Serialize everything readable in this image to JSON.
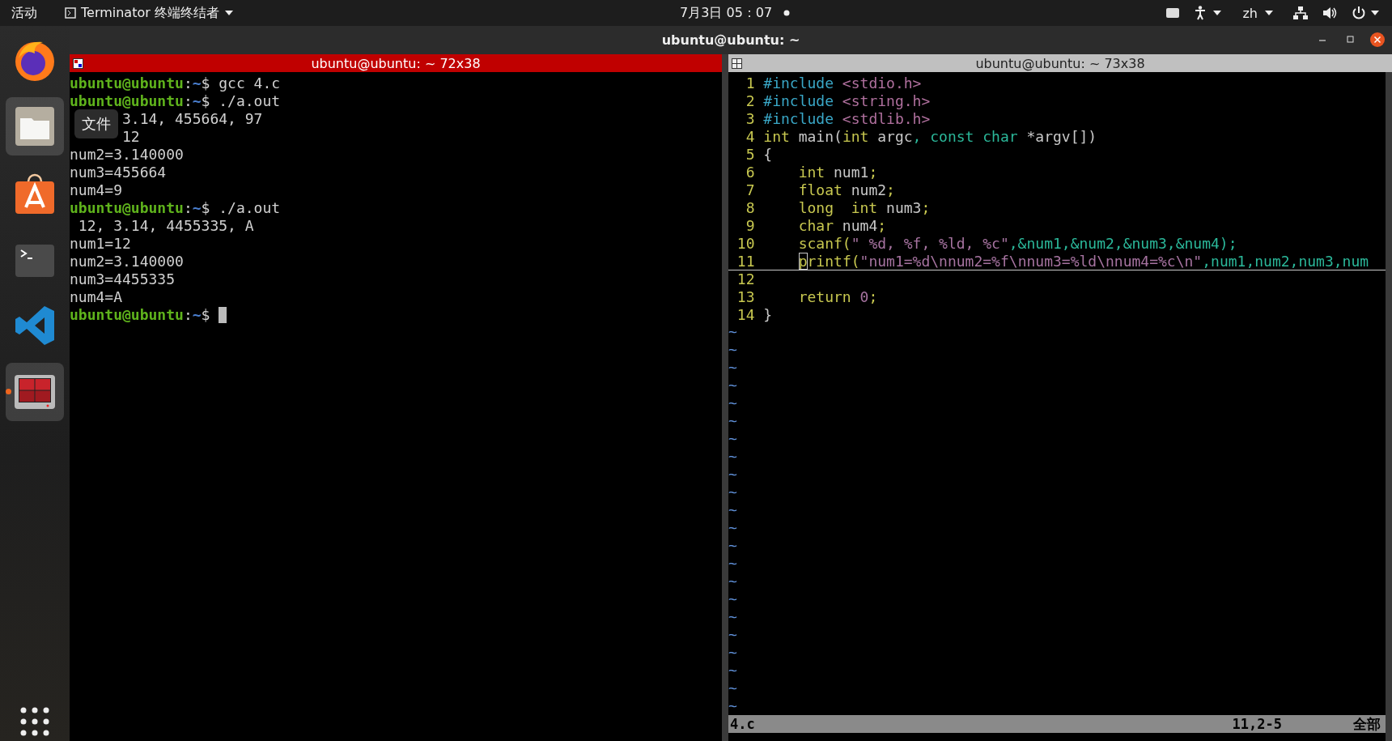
{
  "top_bar": {
    "activities": "活动",
    "app_menu": "Terminator 终端终结者",
    "clock": "7月3日 05：07",
    "notification_dot": true,
    "language": "zh"
  },
  "dock": {
    "items": [
      {
        "kind": "browser",
        "selected": false,
        "running": false
      },
      {
        "kind": "folder",
        "selected": true,
        "running": false
      },
      {
        "kind": "store",
        "selected": false,
        "running": false
      },
      {
        "kind": "console",
        "selected": false,
        "running": false
      },
      {
        "kind": "editor",
        "selected": false,
        "running": false
      },
      {
        "kind": "split",
        "selected": true,
        "running": true
      }
    ],
    "tooltip": "文件"
  },
  "window": {
    "title": "ubuntu@ubuntu: ~"
  },
  "panes": [
    {
      "title": "ubuntu@ubuntu: ~ 72x38",
      "active": true,
      "lines": [
        {
          "kind": "full",
          "segments": [
            {
              "text": "ubuntu@ubuntu",
              "kind": "user"
            },
            {
              "text": ":",
              "kind": "plain"
            },
            {
              "text": "~",
              "kind": "path"
            },
            {
              "text": "$ gcc 4.c",
              "kind": "plain"
            }
          ]
        },
        {
          "kind": "full",
          "segments": [
            {
              "text": "ubuntu@ubuntu",
              "kind": "user"
            },
            {
              "text": ":",
              "kind": "plain"
            },
            {
              "text": "~",
              "kind": "path"
            },
            {
              "text": "$ ./a.out",
              "kind": "plain"
            }
          ]
        },
        {
          "kind": "partial",
          "segments": [
            {
              "text": "3.14, 455664, 97",
              "kind": "plain"
            }
          ]
        },
        {
          "kind": "partial",
          "segments": [
            {
              "text": "12",
              "kind": "plain"
            }
          ]
        },
        {
          "kind": "full",
          "segments": [
            {
              "text": "num2=3.140000",
              "kind": "plain"
            }
          ]
        },
        {
          "kind": "full",
          "segments": [
            {
              "text": "num3=455664",
              "kind": "plain"
            }
          ]
        },
        {
          "kind": "full",
          "segments": [
            {
              "text": "num4=9",
              "kind": "plain"
            }
          ]
        },
        {
          "kind": "full",
          "segments": [
            {
              "text": "ubuntu@ubuntu",
              "kind": "user"
            },
            {
              "text": ":",
              "kind": "plain"
            },
            {
              "text": "~",
              "kind": "path"
            },
            {
              "text": "$ ./a.out",
              "kind": "plain"
            }
          ]
        },
        {
          "kind": "full",
          "segments": [
            {
              "text": " 12, 3.14, 4455335, A",
              "kind": "plain"
            }
          ]
        },
        {
          "kind": "full",
          "segments": [
            {
              "text": "num1=12",
              "kind": "plain"
            }
          ]
        },
        {
          "kind": "full",
          "segments": [
            {
              "text": "num2=3.140000",
              "kind": "plain"
            }
          ]
        },
        {
          "kind": "full",
          "segments": [
            {
              "text": "num3=4455335",
              "kind": "plain"
            }
          ]
        },
        {
          "kind": "full",
          "segments": [
            {
              "text": "num4=A",
              "kind": "plain"
            }
          ]
        },
        {
          "kind": "full",
          "cursor": true,
          "segments": [
            {
              "text": "ubuntu@ubuntu",
              "kind": "user"
            },
            {
              "text": ":",
              "kind": "plain"
            },
            {
              "text": "~",
              "kind": "path"
            },
            {
              "text": "$ ",
              "kind": "plain"
            }
          ]
        }
      ]
    },
    {
      "title": "ubuntu@ubuntu: ~ 73x38",
      "active": false,
      "code": [
        {
          "number": "1",
          "tokens": [
            {
              "text": "#include",
              "kind": "preproc"
            },
            {
              "text": " <stdio.h>",
              "kind": "header"
            }
          ]
        },
        {
          "number": "2",
          "tokens": [
            {
              "text": "#include",
              "kind": "preproc"
            },
            {
              "text": " <string.h>",
              "kind": "header"
            }
          ]
        },
        {
          "number": "3",
          "tokens": [
            {
              "text": "#include",
              "kind": "preproc"
            },
            {
              "text": " <stdlib.h>",
              "kind": "header"
            }
          ]
        },
        {
          "number": "4",
          "tokens": [
            {
              "text": "int",
              "kind": "type"
            },
            {
              "text": " main(",
              "kind": "plain"
            },
            {
              "text": "int",
              "kind": "type"
            },
            {
              "text": " argc",
              "kind": "plain"
            },
            {
              "text": ", const char",
              "kind": "keyword"
            },
            {
              "text": " *argv[])",
              "kind": "plain"
            }
          ]
        },
        {
          "number": "5",
          "tokens": [
            {
              "text": "{",
              "kind": "plain"
            }
          ]
        },
        {
          "number": "6",
          "tokens": [
            {
              "text": "    int",
              "kind": "type"
            },
            {
              "text": " num1",
              "kind": "plain"
            },
            {
              "text": ";",
              "kind": "type"
            }
          ]
        },
        {
          "number": "7",
          "tokens": [
            {
              "text": "    float",
              "kind": "type"
            },
            {
              "text": " num2",
              "kind": "plain"
            },
            {
              "text": ";",
              "kind": "type"
            }
          ]
        },
        {
          "number": "8",
          "tokens": [
            {
              "text": "    long  int",
              "kind": "type"
            },
            {
              "text": " num3",
              "kind": "plain"
            },
            {
              "text": ";",
              "kind": "type"
            }
          ]
        },
        {
          "number": "9",
          "tokens": [
            {
              "text": "    char",
              "kind": "type"
            },
            {
              "text": " num4",
              "kind": "plain"
            },
            {
              "text": ";",
              "kind": "type"
            }
          ]
        },
        {
          "number": "10",
          "tokens": [
            {
              "text": "    scanf(",
              "kind": "type"
            },
            {
              "text": "\" %d, %f, %ld, %c\"",
              "kind": "string"
            },
            {
              "text": ",&num1,&num2,&num3,&num4);",
              "kind": "keyword"
            }
          ]
        },
        {
          "number": "11",
          "current": true,
          "tokens": [
            {
              "text": "    p",
              "kind": "cursor"
            },
            {
              "text": "rintf(",
              "kind": "type"
            },
            {
              "text": "\"num1=%d\\nnum2=%f\\nnum3=%ld\\nnum4=%c\\n\"",
              "kind": "string"
            },
            {
              "text": ",num1,num2,num3,num",
              "kind": "keyword"
            }
          ]
        },
        {
          "number": "12"
        },
        {
          "number": "13",
          "tokens": [
            {
              "text": "    return",
              "kind": "type"
            },
            {
              "text": " 0",
              "kind": "number"
            },
            {
              "text": ";",
              "kind": "type"
            }
          ]
        },
        {
          "number": "14",
          "tokens": [
            {
              "text": "}",
              "kind": "plain"
            }
          ]
        }
      ],
      "empty_line_markers": [
        "~",
        "~",
        "~",
        "~",
        "~",
        "~",
        "~",
        "~",
        "~",
        "~",
        "~",
        "~",
        "~",
        "~",
        "~",
        "~",
        "~",
        "~",
        "~",
        "~",
        "~",
        "~"
      ],
      "status": {
        "file": "4.c",
        "position": "11,2-5",
        "scroll": "全部"
      }
    }
  ]
}
